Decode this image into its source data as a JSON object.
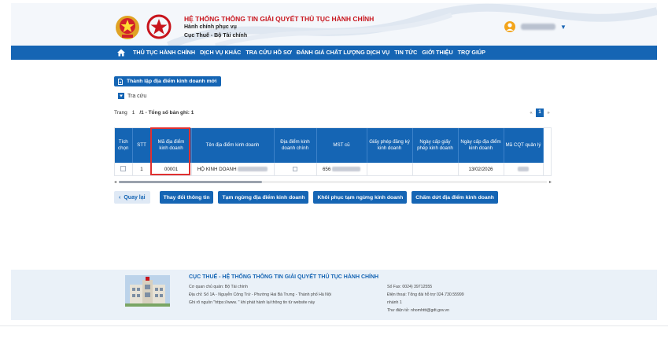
{
  "header": {
    "system_title": "HỆ THỐNG THÔNG TIN GIẢI QUYẾT THỦ TỤC HÀNH CHÍNH",
    "subtitle_1": "Hành chính phục vụ",
    "subtitle_2": "Cục Thuế - Bộ Tài chính",
    "user_menu_icon": "chevron-down-icon"
  },
  "nav": {
    "items": [
      "THỦ TỤC HÀNH CHÍNH",
      "DỊCH VỤ KHÁC",
      "TRA CỨU HỒ SƠ",
      "ĐÁNH GIÁ CHẤT LƯỢNG DỊCH VỤ",
      "TIN TỨC",
      "GIỚI THIỆU",
      "TRỢ GIÚP"
    ]
  },
  "content": {
    "new_button": "Thành lập địa điểm kinh doanh mới",
    "search_toggle": "Tra cứu",
    "paging": {
      "page_label": "Trang",
      "page_value": "1",
      "summary": "/1 - Tổng số bản ghi: 1",
      "pages": [
        "«",
        "1",
        "»"
      ]
    },
    "table": {
      "headers": [
        "Tích chọn",
        "STT",
        "Mã địa điểm kinh doanh",
        "Tên địa điểm kinh doanh",
        "Địa điểm kinh doanh chính",
        "MST cũ",
        "Giấy phép đăng ký kinh doanh",
        "Ngày cấp giấy phép kinh doanh",
        "Ngày cấp địa điểm kinh doanh",
        "Mã CQT quản lý"
      ],
      "rows": [
        {
          "stt": "1",
          "code": "00001",
          "name_prefix": "HỘ KINH DOANH",
          "mst_prefix": "656",
          "issue_date": "13/02/2026"
        }
      ]
    },
    "actions": {
      "back": "Quay lại",
      "buttons": [
        "Thay đổi thông tin",
        "Tạm ngừng địa điểm kinh doanh",
        "Khôi phục tạm ngừng kinh doanh",
        "Chấm dứt địa điểm kinh doanh"
      ]
    }
  },
  "footer": {
    "title": "CỤC THUẾ - HỆ THỐNG THÔNG TIN GIẢI QUYẾT THỦ TỤC HÀNH CHÍNH",
    "agency": "Cơ quan chủ quản: Bộ Tài chính",
    "address": "Địa chỉ: Số 1A - Nguyễn Công Trứ - Phường Hai Bà Trưng - Thành phố Hà Nội",
    "source": "Ghi rõ nguồn \"https://www.                 \" khi phát hành lại thông tin từ website này",
    "phone1": "Số Fax: 0024) 39712555",
    "phone2": "Điện thoại: Tổng đài hỗ trợ 024.730.55999",
    "branch": "nhánh 1",
    "email": "Thư điện tử: nhomhttt@gdt.gov.vn"
  },
  "colors": {
    "primary": "#1565b4",
    "title_red": "#c8141c",
    "highlight": "#e03030"
  }
}
